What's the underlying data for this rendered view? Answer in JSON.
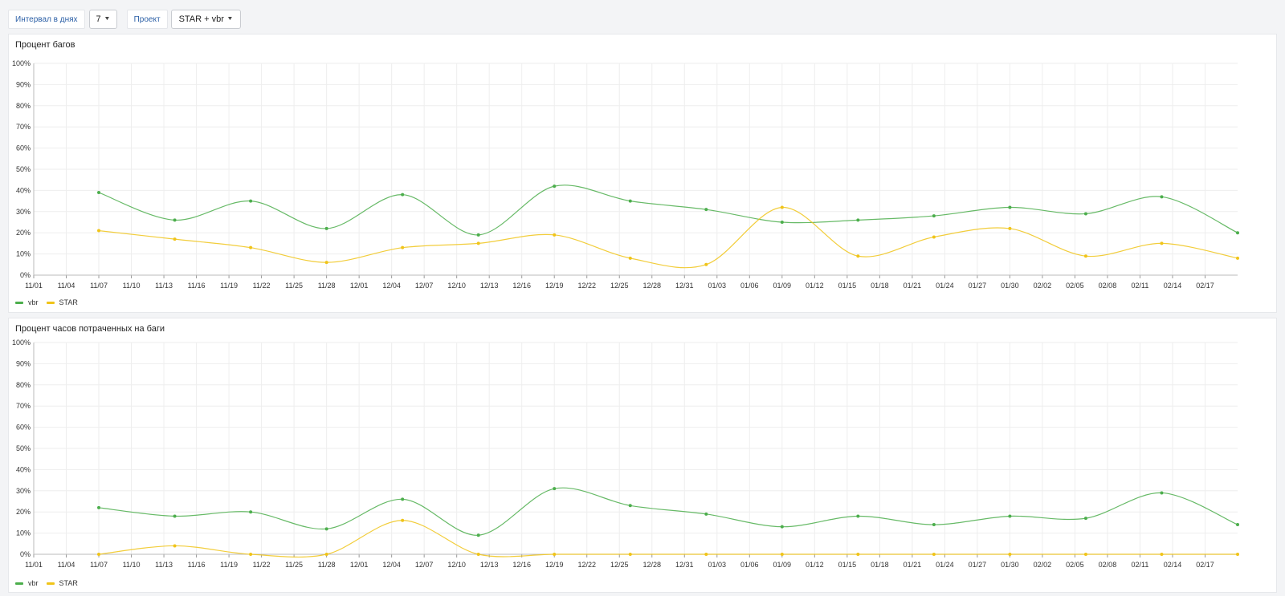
{
  "filters": {
    "interval_label": "Интервал в днях",
    "interval_value": "7",
    "project_label": "Проект",
    "project_value": "STAR + vbr"
  },
  "colors": {
    "vbr": "#4cae4c",
    "STAR": "#f0c419",
    "grid": "#eeeeee",
    "axis": "#444444"
  },
  "x_tick_labels": [
    "11/01",
    "11/04",
    "11/07",
    "11/10",
    "11/13",
    "11/16",
    "11/19",
    "11/22",
    "11/25",
    "11/28",
    "12/01",
    "12/04",
    "12/07",
    "12/10",
    "12/13",
    "12/16",
    "12/19",
    "12/22",
    "12/25",
    "12/28",
    "12/31",
    "01/03",
    "01/06",
    "01/09",
    "01/12",
    "01/15",
    "01/18",
    "01/21",
    "01/24",
    "01/27",
    "01/30",
    "02/02",
    "02/05",
    "02/08",
    "02/11",
    "02/14",
    "02/17"
  ],
  "y_tick_labels": [
    "0%",
    "10%",
    "20%",
    "30%",
    "40%",
    "50%",
    "60%",
    "70%",
    "80%",
    "90%",
    "100%"
  ],
  "chart_data": [
    {
      "type": "line",
      "title": "Процент багов",
      "x": [
        "11/07",
        "11/14",
        "11/21",
        "11/28",
        "12/05",
        "12/12",
        "12/19",
        "12/26",
        "01/02",
        "01/09",
        "01/16",
        "01/23",
        "01/30",
        "02/06",
        "02/13",
        "02/20"
      ],
      "series": [
        {
          "name": "vbr",
          "values": [
            39,
            26,
            35,
            22,
            38,
            19,
            42,
            35,
            31,
            25,
            26,
            28,
            32,
            29,
            37,
            20
          ]
        },
        {
          "name": "STAR",
          "values": [
            21,
            17,
            13,
            6,
            13,
            15,
            19,
            8,
            5,
            32,
            9,
            18,
            22,
            9,
            15,
            8
          ]
        }
      ],
      "ylim": [
        0,
        100
      ],
      "grid": true,
      "legend_position": "bottom-left"
    },
    {
      "type": "line",
      "title": "Процент часов потраченных на баги",
      "x": [
        "11/07",
        "11/14",
        "11/21",
        "11/28",
        "12/05",
        "12/12",
        "12/19",
        "12/26",
        "01/02",
        "01/09",
        "01/16",
        "01/23",
        "01/30",
        "02/06",
        "02/13",
        "02/20"
      ],
      "series": [
        {
          "name": "vbr",
          "values": [
            22,
            18,
            20,
            12,
            26,
            9,
            31,
            23,
            19,
            13,
            18,
            14,
            18,
            17,
            29,
            14
          ]
        },
        {
          "name": "STAR",
          "values": [
            0,
            4,
            0,
            0,
            16,
            0,
            0,
            0,
            0,
            0,
            0,
            0,
            0,
            0,
            0,
            0
          ]
        }
      ],
      "ylim": [
        0,
        100
      ],
      "grid": true,
      "legend_position": "bottom-left"
    }
  ]
}
